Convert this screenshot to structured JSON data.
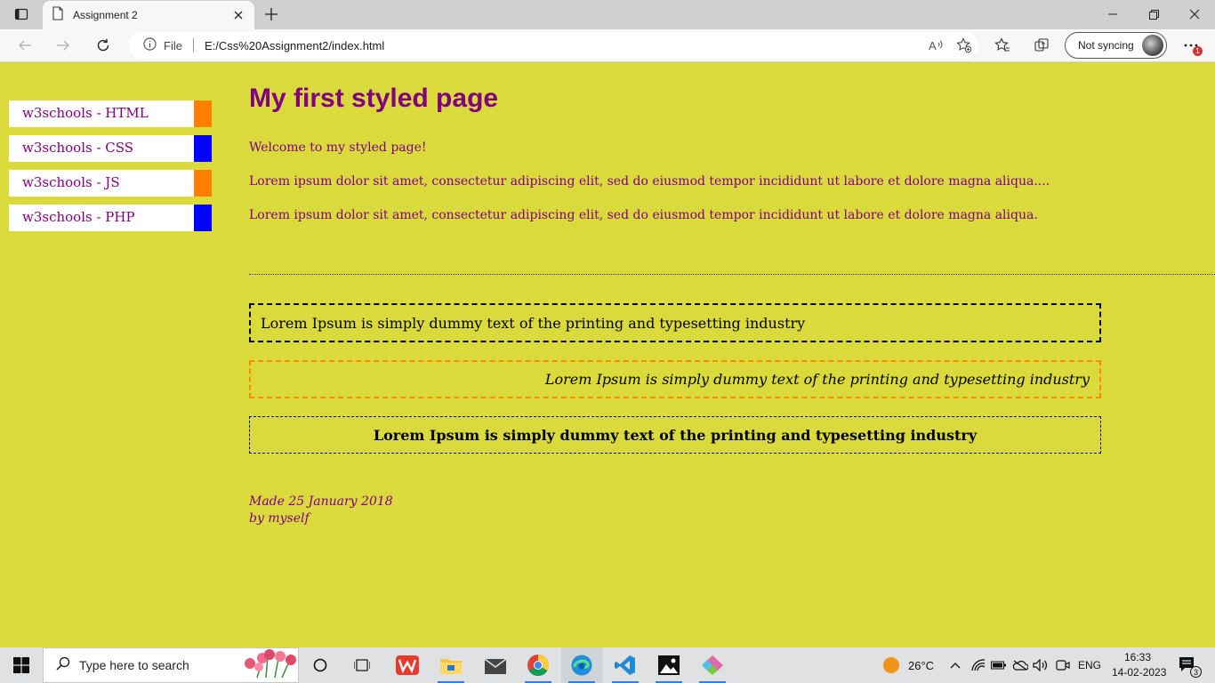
{
  "browser": {
    "tab_title": "Assignment 2",
    "address_prefix": "File",
    "url": "E:/Css%20Assignment2/index.html",
    "sync_label": "Not syncing",
    "notification_count": "1"
  },
  "page": {
    "nav": [
      {
        "label": "w3schools - HTML",
        "accent": "#ff8000"
      },
      {
        "label": "w3schools - CSS",
        "accent": "#0000ff"
      },
      {
        "label": "w3schools - JS",
        "accent": "#ff8000"
      },
      {
        "label": "w3schools - PHP",
        "accent": "#0000ff"
      }
    ],
    "heading": "My first styled page",
    "welcome": "Welcome to my styled page!",
    "paragraph1": "Lorem ipsum dolor sit amet, consectetur adipiscing elit, sed do eiusmod tempor incididunt ut labore et dolore magna aliqua....",
    "paragraph2": "Lorem ipsum dolor sit amet, consectetur adipiscing elit, sed do eiusmod tempor incididunt ut labore et dolore magna aliqua.",
    "box1": "Lorem Ipsum is simply dummy text of the printing and typesetting industry",
    "box2": "Lorem Ipsum is simply dummy text of the printing and typesetting industry",
    "box3": "Lorem Ipsum is simply dummy text of the printing and typesetting industry",
    "footer_line1": "Made 25 January 2018",
    "footer_line2": "by myself"
  },
  "colors": {
    "page_background": "#dada3c",
    "text_purple": "#800080"
  },
  "taskbar": {
    "search_placeholder": "Type here to search",
    "weather": "26°C",
    "language": "ENG",
    "time": "16:33",
    "date": "14-02-2023",
    "notifications": "3",
    "pinned_icons": [
      "cortana-icon",
      "task-view-icon",
      "wps-office-icon",
      "file-explorer-icon",
      "mail-icon",
      "chrome-icon",
      "edge-icon",
      "vscode-icon",
      "photos-icon",
      "git-icon"
    ]
  }
}
